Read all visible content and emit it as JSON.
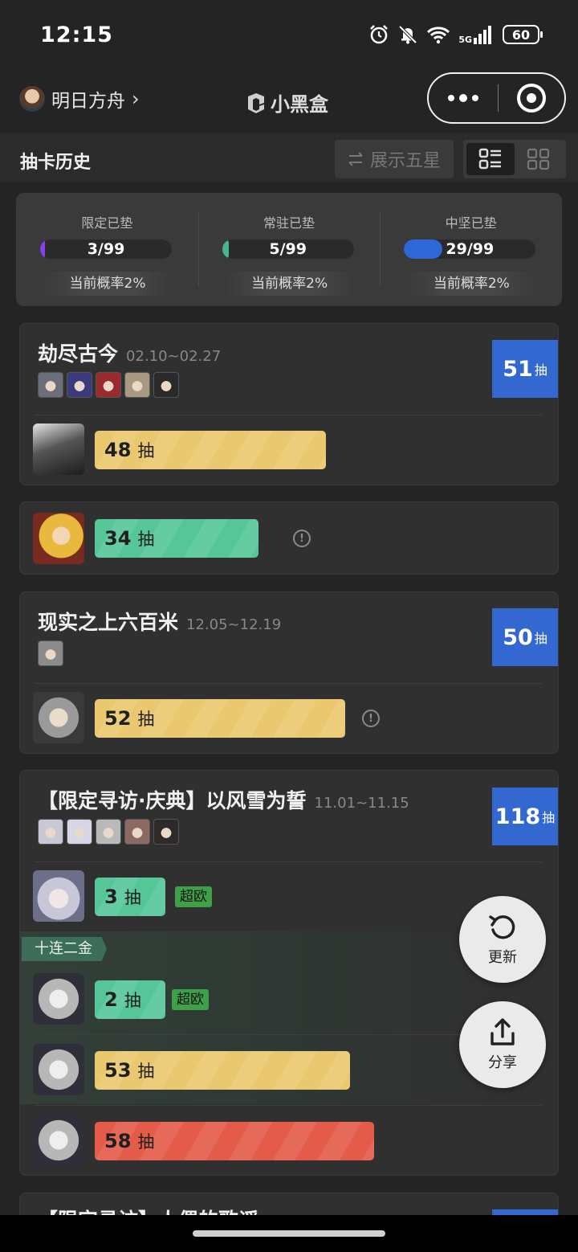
{
  "status": {
    "time": "12:15",
    "network": "5G",
    "battery": "60"
  },
  "nav": {
    "game_name": "明日方舟",
    "app_name": "小黑盒"
  },
  "header": {
    "title": "抽卡历史",
    "filter_label": "展示五星"
  },
  "pity": [
    {
      "label": "限定已垫",
      "value": "3/99",
      "fraction": 0.0303,
      "color": "#8a3ff0",
      "rate": "当前概率2%"
    },
    {
      "label": "常驻已垫",
      "value": "5/99",
      "fraction": 0.0505,
      "color": "#49b38f",
      "rate": "当前概率2%"
    },
    {
      "label": "中坚已垫",
      "value": "29/99",
      "fraction": 0.2929,
      "color": "#2f67d6",
      "rate": "当前概率2%"
    }
  ],
  "pull_unit": "抽",
  "banners": [
    {
      "title": "劫尽古今",
      "date": "02.10~02.27",
      "total": "51",
      "unit": "抽",
      "mini_colors": [
        "#6b6f7a",
        "#3b3a7c",
        "#9a2a2c",
        "#a89a82",
        "#2b2a2a"
      ],
      "pulls": [
        {
          "count": "48",
          "fraction": 0.48,
          "color": "yellow"
        }
      ]
    },
    {
      "pulls": [
        {
          "count": "34",
          "fraction": 0.34,
          "color": "green"
        }
      ]
    },
    {
      "title": "现实之上六百米",
      "date": "12.05~12.19",
      "total": "50",
      "unit": "抽",
      "mini_colors": [
        "#8b8b8b"
      ],
      "pulls": [
        {
          "count": "52",
          "fraction": 0.52,
          "color": "yellow"
        }
      ]
    },
    {
      "title": "【限定寻访·庆典】以风雪为誓",
      "date": "11.01~11.15",
      "total": "118",
      "unit": "抽",
      "mini_colors": [
        "#c9c9d6",
        "#d6d6e4",
        "#b9b9b9",
        "#8c6a63",
        "#2e2a2a"
      ],
      "group_label": "十连二金",
      "lucky_tag": "超欧",
      "pulls": [
        {
          "count": "3",
          "fraction": 0.03,
          "color": "green",
          "tag": "超欧"
        },
        {
          "count": "2",
          "fraction": 0.02,
          "color": "green",
          "tag": "超欧"
        },
        {
          "count": "53",
          "fraction": 0.53,
          "color": "yellow"
        },
        {
          "count": "58",
          "fraction": 0.58,
          "color": "red"
        }
      ]
    }
  ],
  "peek_title": "【限定寻访】人偶的歌谣",
  "fab": {
    "refresh": "更新",
    "share": "分享"
  }
}
